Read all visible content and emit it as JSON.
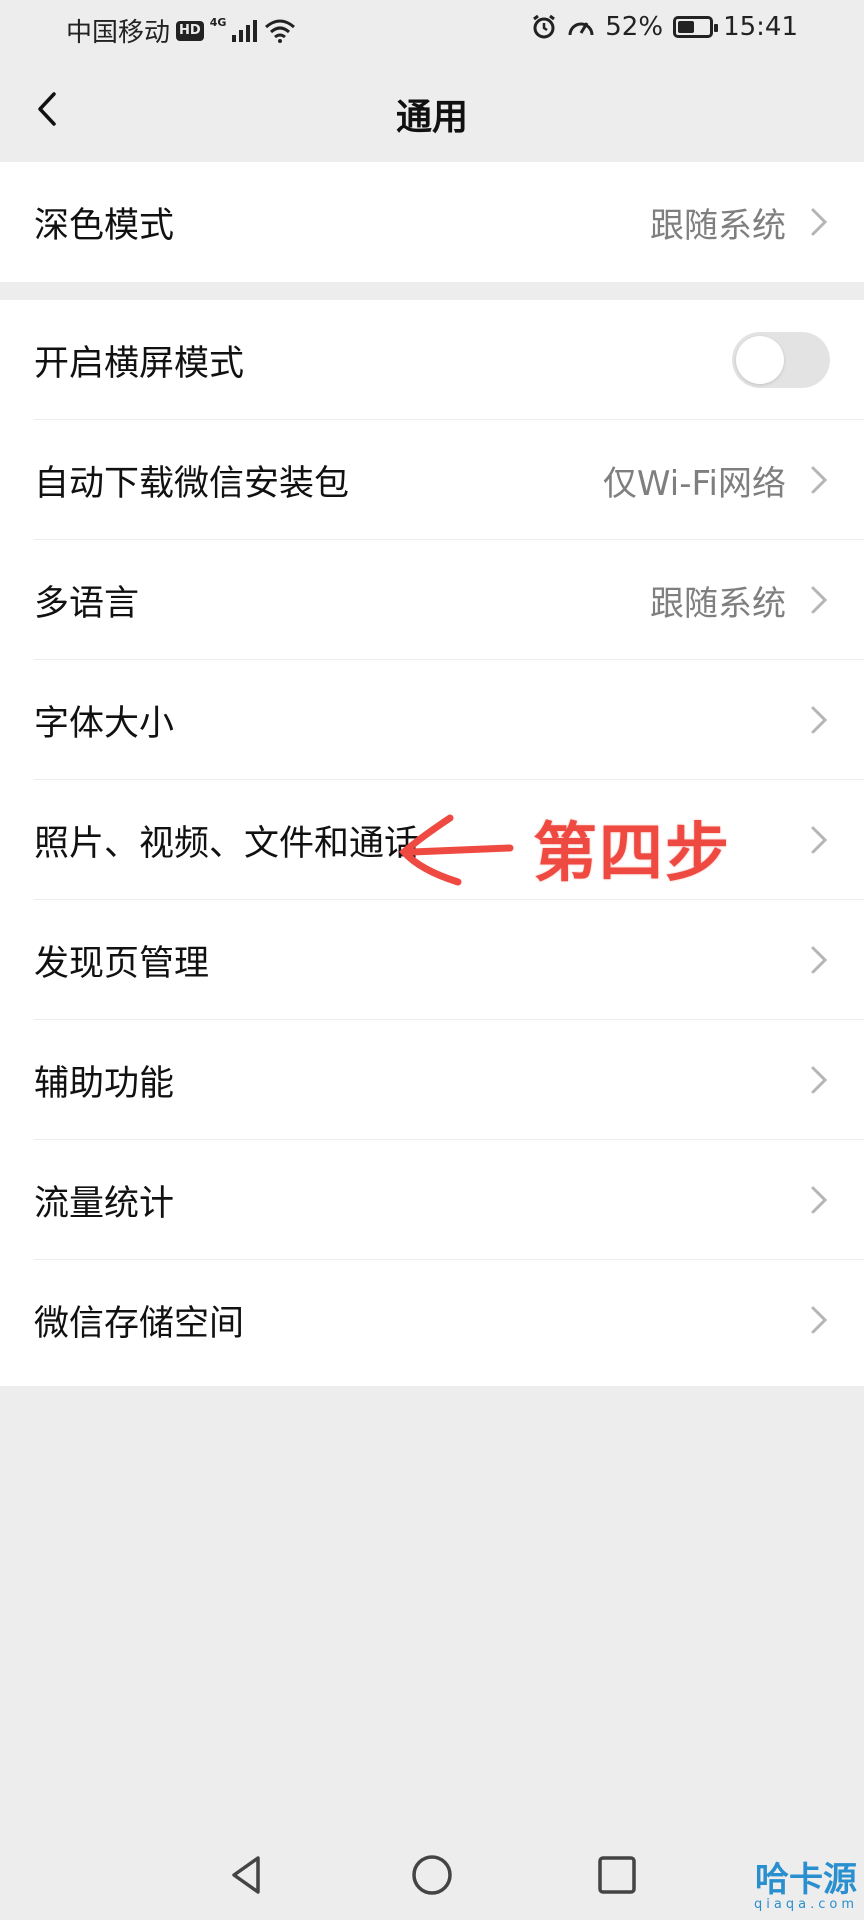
{
  "status_bar": {
    "carrier": "中国移动",
    "hd": "HD",
    "network": "4G",
    "battery_percent": "52%",
    "battery_level": 0.52,
    "time": "15:41",
    "icons": [
      "signal-icon",
      "wifi-icon",
      "alarm-icon",
      "speed-icon",
      "battery-icon"
    ]
  },
  "nav": {
    "title": "通用",
    "back_icon": "back-chevron-icon"
  },
  "group1": {
    "items": [
      {
        "label": "深色模式",
        "value": "跟随系统"
      }
    ]
  },
  "group2": {
    "items": [
      {
        "label": "开启横屏模式",
        "toggle": false
      },
      {
        "label": "自动下载微信安装包",
        "value": "仅Wi-Fi网络"
      },
      {
        "label": "多语言",
        "value": "跟随系统"
      },
      {
        "label": "字体大小"
      },
      {
        "label": "照片、视频、文件和通话"
      },
      {
        "label": "发现页管理"
      },
      {
        "label": "辅助功能"
      },
      {
        "label": "流量统计"
      },
      {
        "label": "微信存储空间"
      }
    ]
  },
  "annotation": {
    "text": "第四步",
    "color": "#ef4a41"
  },
  "system_nav": {
    "buttons": [
      "back-triangle-icon",
      "home-circle-icon",
      "recents-square-icon"
    ]
  },
  "watermark": {
    "text": "哈卡源",
    "sub": "qiaqa.com"
  }
}
